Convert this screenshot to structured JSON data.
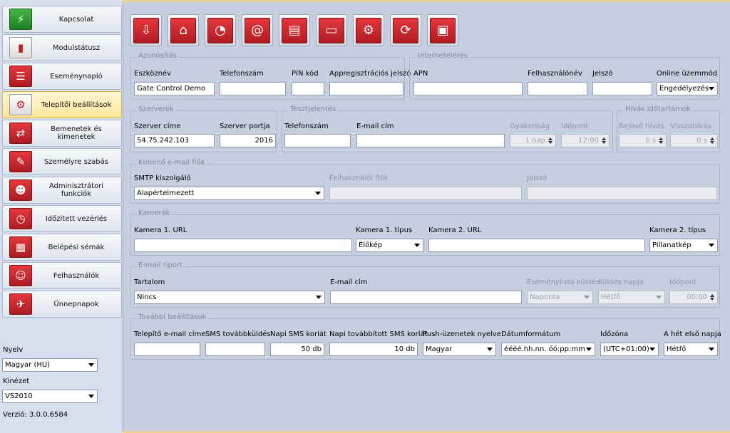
{
  "sidebar": {
    "items": [
      {
        "label": "Kapcsolat",
        "icon": "usb-icon"
      },
      {
        "label": "Modulstátusz",
        "icon": "status-chart-icon"
      },
      {
        "label": "Eseménynapló",
        "icon": "event-log-icon"
      },
      {
        "label": "Telepítői beállítások",
        "icon": "installer-settings-icon",
        "active": true
      },
      {
        "label": "Bemenetek és kimenetek",
        "icon": "io-icon"
      },
      {
        "label": "Személyre szabás",
        "icon": "customize-icon"
      },
      {
        "label": "Adminisztrátori funkciók",
        "icon": "admin-icon"
      },
      {
        "label": "Időzített vezérlés",
        "icon": "timer-icon"
      },
      {
        "label": "Belépési sémák",
        "icon": "access-scheme-icon"
      },
      {
        "label": "Felhasználók",
        "icon": "users-icon"
      },
      {
        "label": "Ünnepnapok",
        "icon": "holiday-icon"
      }
    ],
    "language_label": "Nyelv",
    "language_value": "Magyar (HU)",
    "theme_label": "Kinézet",
    "theme_value": "VS2010",
    "version": "Verzió: 3.0.0.6584"
  },
  "toolbar": [
    "download-icon",
    "upload-icon",
    "schedule-icon",
    "email-send-icon",
    "save-file-icon",
    "open-folder-icon",
    "gear-save-icon",
    "gear-refresh-icon",
    "chip-icon"
  ],
  "azonositas": {
    "title": "Azonosítás",
    "device_name_label": "Eszköznév",
    "device_name_value": "Gate Control Demo",
    "phone_label": "Telefonszám",
    "phone_value": "",
    "pin_label": "PIN kód",
    "pin_value": "",
    "appreg_label": "Appregisztrációs jelszó",
    "appreg_value": ""
  },
  "internet": {
    "title": "Internetelérés",
    "apn_label": "APN",
    "apn_value": "",
    "user_label": "Felhasználónév",
    "user_value": "",
    "pass_label": "Jelszó",
    "pass_value": "",
    "online_label": "Online üzemmód",
    "online_value": "Engedélyezés"
  },
  "szerverek": {
    "title": "Szerverek",
    "addr_label": "Szerver címe",
    "addr_value": "54.75.242.103",
    "port_label": "Szerver portja",
    "port_value": "2016"
  },
  "teszt": {
    "title": "Tesztjelentés",
    "phone_label": "Telefonszám",
    "phone_value": "",
    "email_label": "E-mail cím",
    "email_value": "",
    "freq_label": "Gyakoriság",
    "freq_value": "1 nap",
    "time_label": "Időpont",
    "time_value": "12:00"
  },
  "hivas": {
    "title": "Hívás időtartamok",
    "in_label": "Bejövő hívás",
    "in_value": "0 s",
    "back_label": "Visszahívás",
    "back_value": "0 s"
  },
  "kimeno": {
    "title": "Kimenő e-mail fiók",
    "smtp_label": "SMTP kiszolgáló",
    "smtp_value": "Alapértelmezett",
    "account_label": "Felhasználói fiók",
    "account_value": "",
    "pass_label": "Jelszó",
    "pass_value": ""
  },
  "kamerak": {
    "title": "Kamerák",
    "url1_label": "Kamera 1. URL",
    "url1_value": "",
    "type1_label": "Kamera 1. típus",
    "type1_value": "Élőkép",
    "url2_label": "Kamera 2. URL",
    "url2_value": "",
    "type2_label": "Kamera 2. típus",
    "type2_value": "Pillanatkép"
  },
  "riport": {
    "title": "E-mail riport",
    "content_label": "Tartalom",
    "content_value": "Nincs",
    "email_label": "E-mail cím",
    "email_value": "",
    "send_label": "Eseménylista küldés",
    "send_value": "Naponta",
    "day_label": "Küldés napja",
    "day_value": "Hétfő",
    "time_label": "Időpont",
    "time_value": "00:00"
  },
  "tovabbi": {
    "title": "További beállítások",
    "inst_email_label": "Telepítő e-mail címe",
    "inst_email_value": "",
    "sms_fwd_label": "SMS továbbküldés",
    "sms_fwd_value": "",
    "daily_sms_label": "Napi SMS korlát",
    "daily_sms_value": "50 db",
    "daily_fwd_label": "Napi továbbított SMS korlát",
    "daily_fwd_value": "10 db",
    "push_label": "Push-üzenetek nyelve",
    "push_value": "Magyar",
    "date_label": "Dátumformátum",
    "date_value": "éééé.hh.nn. óó:pp:mm",
    "tz_label": "Időzóna",
    "tz_value": "(UTC+01:00)",
    "week_label": "A hét első napja",
    "week_value": "Hétfő"
  }
}
